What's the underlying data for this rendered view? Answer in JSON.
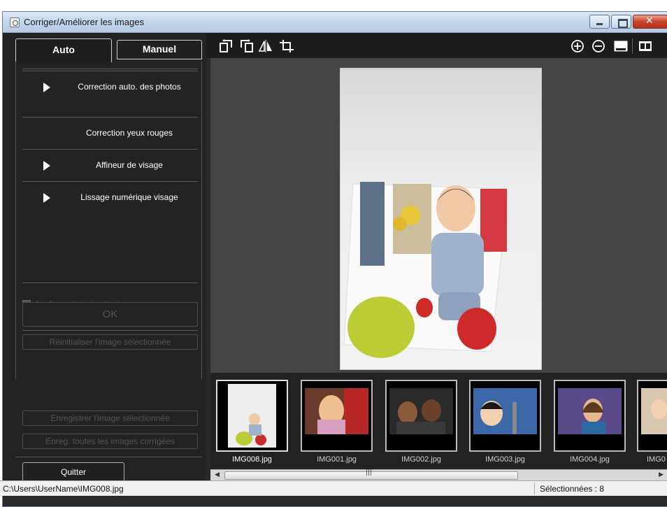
{
  "window": {
    "title": "Corriger/Améliorer les images"
  },
  "tabs": {
    "auto": "Auto",
    "manuel": "Manuel"
  },
  "menu": [
    {
      "label": "Correction auto. des photos",
      "has_arrow": true
    },
    {
      "label": "Correction yeux rouges",
      "has_arrow": false
    },
    {
      "label": "Affineur de visage",
      "has_arrow": true
    },
    {
      "label": "Lissage numérique visage",
      "has_arrow": true
    }
  ],
  "options": {
    "apply_all": "Appliquer à toutes les images",
    "ok": "OK",
    "reset": "Réinitialiser l'image sélectionnée",
    "save_selected": "Enregistrer l'image sélectionnée",
    "save_all": "Enreg. toutes les images corrigées",
    "quit": "Quitter"
  },
  "toolbar": {
    "left_icons": [
      "rotate-left-icon",
      "rotate-right-icon",
      "flip-horizontal-icon",
      "crop-icon"
    ],
    "right_icons": [
      "zoom-in-icon",
      "zoom-out-icon",
      "single-view-icon",
      "compare-view-icon"
    ]
  },
  "thumbnails": [
    {
      "name": "IMG008.jpg",
      "selected": true
    },
    {
      "name": "IMG001.jpg",
      "selected": false
    },
    {
      "name": "IMG002.jpg",
      "selected": false
    },
    {
      "name": "IMG003.jpg",
      "selected": false
    },
    {
      "name": "IMG004.jpg",
      "selected": false
    },
    {
      "name": "IMG0",
      "selected": false
    }
  ],
  "status": {
    "path": "C:\\Users\\UserName\\IMG008.jpg",
    "selected": "Sélectionnées : 8"
  },
  "colors": {
    "panel": "#232323",
    "preview_bg": "#444444",
    "close_button": "#c8432a"
  }
}
